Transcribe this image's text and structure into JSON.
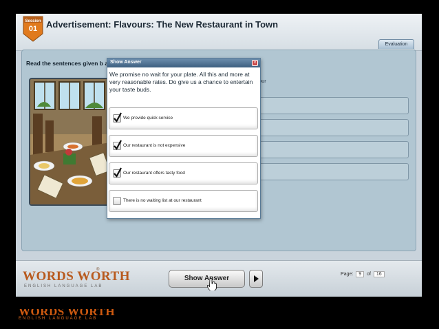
{
  "header": {
    "session_label": "Session",
    "session_number": "01",
    "title": "Advertisement: Flavours: The New Restaurant in Town",
    "evaluation_tab": "Evaluation"
  },
  "content": {
    "instruction": "Read the sentences given b                                                                                                                 aning.",
    "passage": "ery reasonable rates. Do give us a chance to entertain your"
  },
  "popup": {
    "title": "Show Answer",
    "close_glyph": "×",
    "text": "We promise no wait for your plate. All this and more at very reasonable rates. Do give us a chance to entertain your taste buds.",
    "options": [
      {
        "label": "We provide quick service",
        "checked": true
      },
      {
        "label": "Our restaurant is not expensive",
        "checked": true
      },
      {
        "label": "Our restaurant offers tasty food",
        "checked": true
      },
      {
        "label": "There is no waiting list at our restaurant",
        "checked": false
      }
    ]
  },
  "footer": {
    "logo_text": "WORDS WORTH",
    "logo_trademark": "®",
    "logo_subtitle": "ENGLISH LANGUAGE LAB",
    "show_answer_label": "Show Answer",
    "page_label": "Page:",
    "page_current": "9",
    "page_of": "of",
    "page_total": "16"
  },
  "watermark": {
    "logo_text": "WORDS WORTH",
    "subtitle": "ENGLISH LANGUAGE LAB"
  },
  "colors": {
    "accent_orange": "#cf5a10",
    "popup_titlebar": "#4a6d8f",
    "panel_background": "#b1c6d2"
  }
}
